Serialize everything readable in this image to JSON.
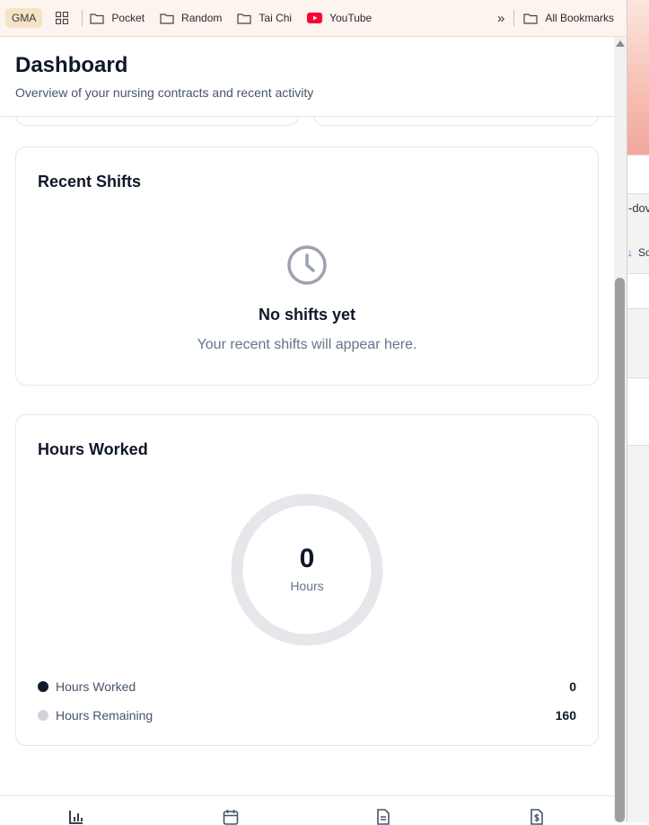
{
  "bookmarks": {
    "badge": "GMA",
    "items": [
      {
        "label": "Pocket",
        "icon": "folder-icon"
      },
      {
        "label": "Random",
        "icon": "folder-icon"
      },
      {
        "label": "Tai Chi",
        "icon": "folder-icon"
      },
      {
        "label": "YouTube",
        "icon": "youtube-icon"
      }
    ],
    "overflow": "»",
    "all_bookmarks": "All Bookmarks"
  },
  "background_window": {
    "text1": "-dov",
    "text2": "Sc"
  },
  "header": {
    "title": "Dashboard",
    "subtitle": "Overview of your nursing contracts and recent activity"
  },
  "recent_shifts": {
    "title": "Recent Shifts",
    "icon": "clock-icon",
    "empty_title": "No shifts yet",
    "empty_description": "Your recent shifts will appear here."
  },
  "hours_worked": {
    "title": "Hours Worked",
    "total_value": "0",
    "total_label": "Hours",
    "worked_fraction": 0,
    "legend": [
      {
        "label": "Hours Worked",
        "value": "0",
        "color": "#111827"
      },
      {
        "label": "Hours Remaining",
        "value": "160",
        "color": "#d1d5db"
      }
    ]
  },
  "bottom_nav": {
    "items": [
      {
        "icon": "bar-chart-icon"
      },
      {
        "icon": "calendar-icon"
      },
      {
        "icon": "document-icon"
      },
      {
        "icon": "dollar-document-icon"
      }
    ]
  },
  "colors": {
    "ring_track": "#e5e7eb",
    "text_primary": "#0f172a",
    "text_muted": "#64748b",
    "card_border": "#e5e7eb",
    "bookmarks_bar": "#fdf3ef"
  }
}
